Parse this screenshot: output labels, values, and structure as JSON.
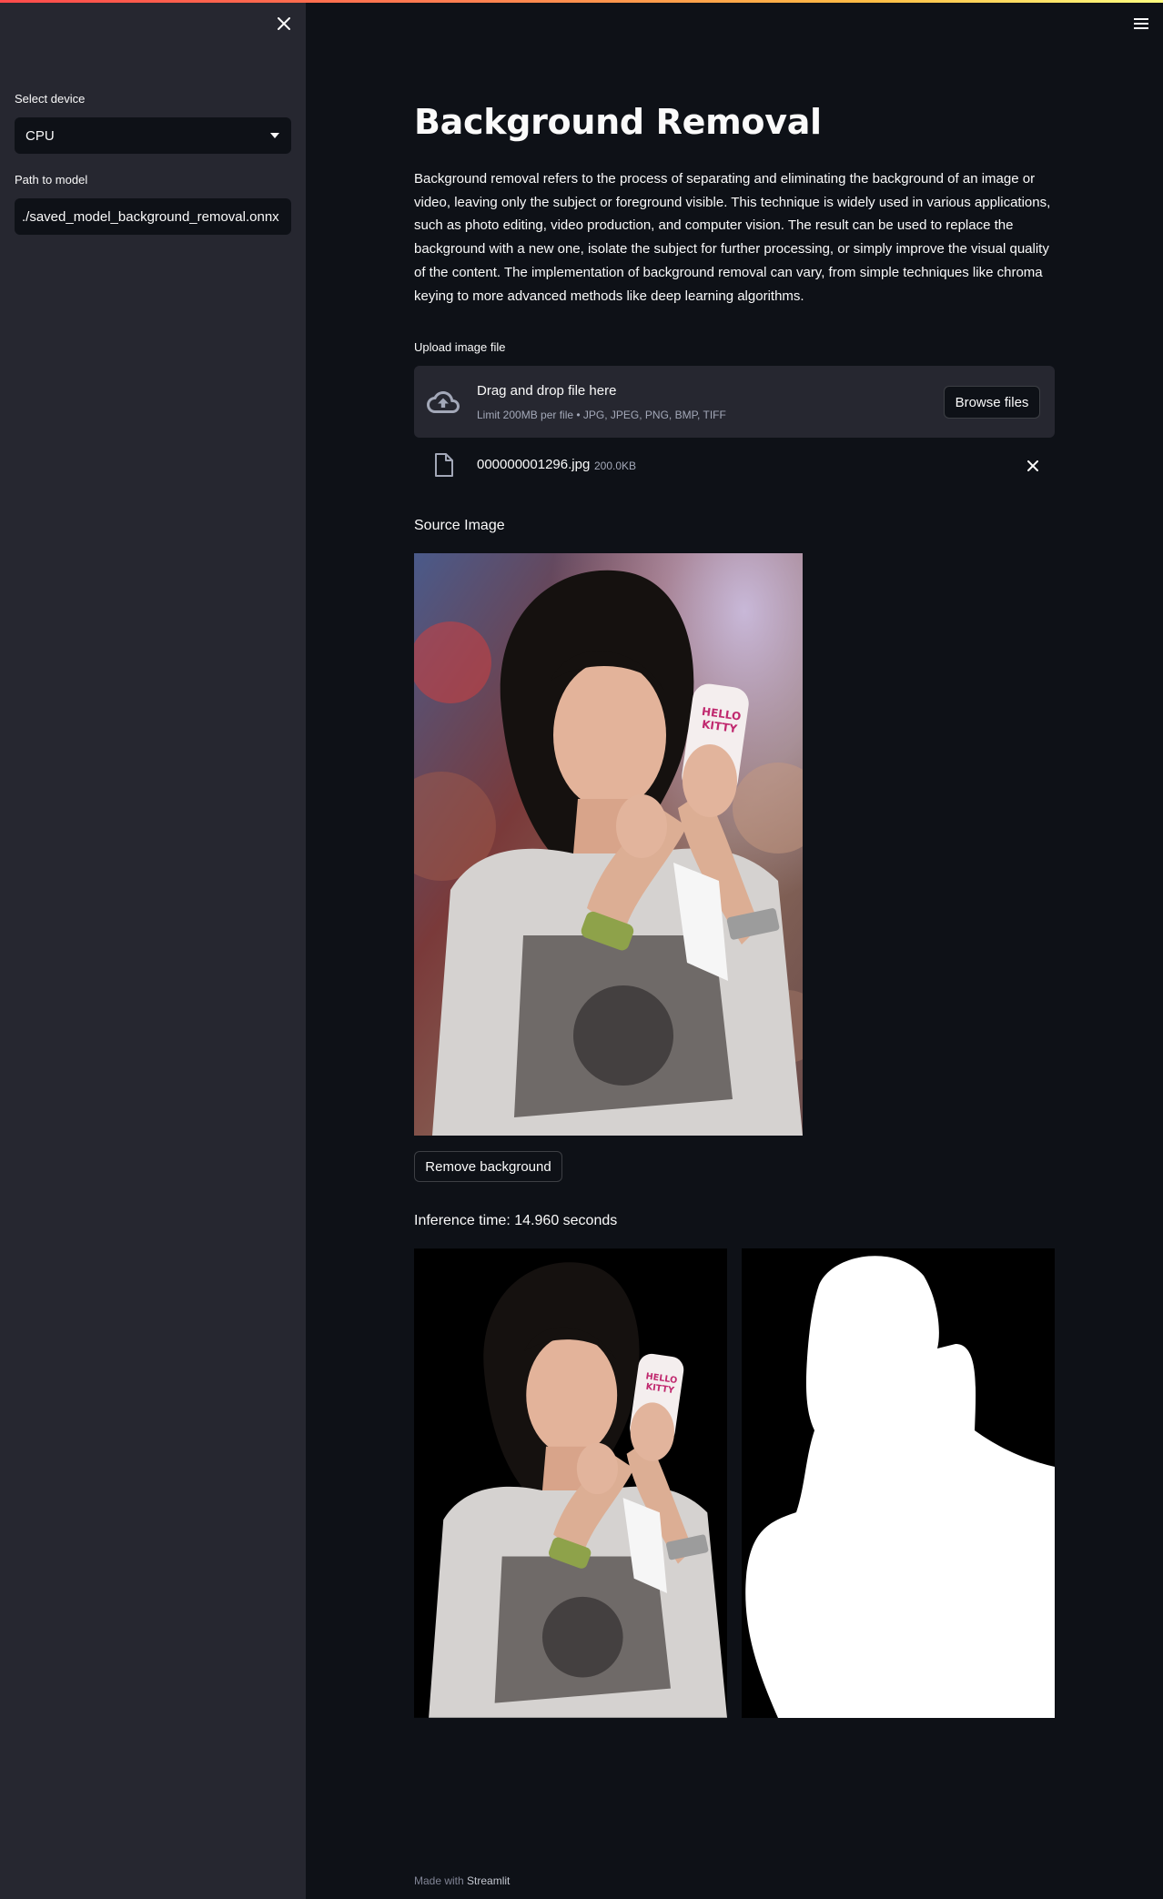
{
  "sidebar": {
    "device_label": "Select device",
    "device_value": "CPU",
    "model_label": "Path to model",
    "model_value": "./saved_model_background_removal.onnx"
  },
  "main": {
    "title": "Background Removal",
    "description": "Background removal refers to the process of separating and eliminating the background of an image or video, leaving only the subject or foreground visible. This technique is widely used in various applications, such as photo editing, video production, and computer vision. The result can be used to replace the background with a new one, isolate the subject for further processing, or simply improve the visual quality of the content. The implementation of background removal can vary, from simple techniques like chroma keying to more advanced methods like deep learning algorithms.",
    "uploader": {
      "label": "Upload image file",
      "drag_text": "Drag and drop file here",
      "limit_text": "Limit 200MB per file • JPG, JPEG, PNG, BMP, TIFF",
      "browse_label": "Browse files"
    },
    "file": {
      "name": "000000001296.jpg",
      "size": "200.0KB"
    },
    "source_label": "Source Image",
    "remove_button": "Remove background",
    "inference_text": "Inference time: 14.960 seconds"
  },
  "footer": {
    "prefix": "Made with",
    "brand": "Streamlit"
  },
  "colors": {
    "background": "#0e1117",
    "sidebar": "#262730",
    "text": "#fafafa",
    "muted": "#a3a8b8"
  }
}
